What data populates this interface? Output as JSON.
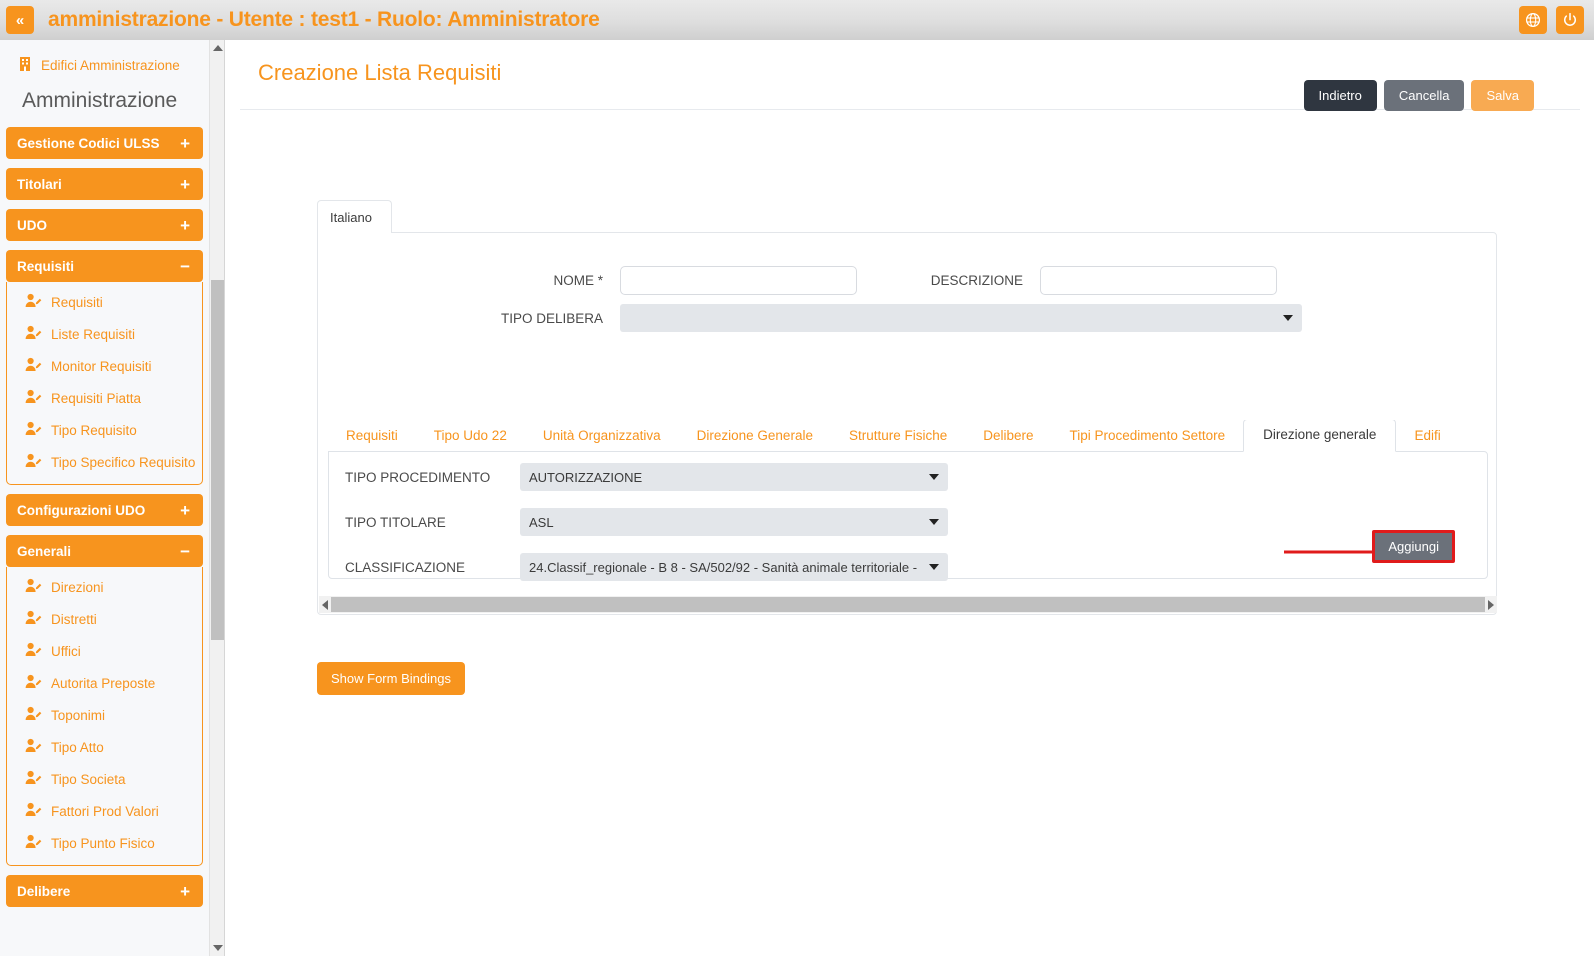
{
  "topbar": {
    "collapse_label": "«",
    "title": "amministrazione - Utente : test1 - Ruolo: Amministratore",
    "language_icon": "globe-icon",
    "logout_icon": "power-icon"
  },
  "sidebar": {
    "top_link": {
      "icon": "building-icon",
      "label": "Edifici Amministrazione"
    },
    "heading": "Amministrazione",
    "groups": [
      {
        "label": "Gestione Codici ULSS",
        "sign": "+",
        "expanded": false,
        "items": []
      },
      {
        "label": "Titolari",
        "sign": "+",
        "expanded": false,
        "items": []
      },
      {
        "label": "UDO",
        "sign": "+",
        "expanded": false,
        "items": []
      },
      {
        "label": "Requisiti",
        "sign": "−",
        "expanded": true,
        "items": [
          "Requisiti",
          "Liste Requisiti",
          "Monitor Requisiti",
          "Requisiti Piatta",
          "Tipo Requisito",
          "Tipo Specifico Requisito"
        ]
      },
      {
        "label": "Configurazioni UDO",
        "sign": "+",
        "expanded": false,
        "items": []
      },
      {
        "label": "Generali",
        "sign": "−",
        "expanded": true,
        "items": [
          "Direzioni",
          "Distretti",
          "Uffici",
          "Autorita Preposte",
          "Toponimi",
          "Tipo Atto",
          "Tipo Societa",
          "Fattori Prod Valori",
          "Tipo Punto Fisico"
        ]
      },
      {
        "label": "Delibere",
        "sign": "+",
        "expanded": false,
        "items": []
      }
    ]
  },
  "page": {
    "title": "Creazione Lista Requisiti",
    "actions": {
      "back": "Indietro",
      "cancel": "Cancella",
      "save": "Salva"
    }
  },
  "form": {
    "language_tab": "Italiano",
    "nome": {
      "label": "NOME *",
      "value": "",
      "placeholder": ""
    },
    "descrizione": {
      "label": "DESCRIZIONE",
      "value": "",
      "placeholder": ""
    },
    "tipo_delibera": {
      "label": "TIPO DELIBERA",
      "value": ""
    }
  },
  "tabs": [
    {
      "label": "Requisiti",
      "active": false
    },
    {
      "label": "Tipo Udo 22",
      "active": false
    },
    {
      "label": "Unità Organizzativa",
      "active": false
    },
    {
      "label": "Direzione Generale",
      "active": false
    },
    {
      "label": "Strutture Fisiche",
      "active": false
    },
    {
      "label": "Delibere",
      "active": false
    },
    {
      "label": "Tipi Procedimento Settore",
      "active": false
    },
    {
      "label": "Direzione generale",
      "active": true
    },
    {
      "label": "Edifi",
      "active": false
    }
  ],
  "tabpanel": {
    "tipo_procedimento": {
      "label": "TIPO PROCEDIMENTO",
      "value": "AUTORIZZAZIONE"
    },
    "tipo_titolare": {
      "label": "TIPO TITOLARE",
      "value": "ASL"
    },
    "classificazione": {
      "label": "CLASSIFICAZIONE",
      "value": "24.Classif_regionale - B 8 - SA/502/92 - Sanità animale territoriale - "
    },
    "add_button": "Aggiungi"
  },
  "footer": {
    "show_bindings": "Show Form Bindings"
  },
  "colors": {
    "accent_orange": "#f7941e",
    "annotation_red": "#e01b1b",
    "dark_button": "#2f3640",
    "grey_button": "#6b717a",
    "save_button": "#f8aa52"
  }
}
